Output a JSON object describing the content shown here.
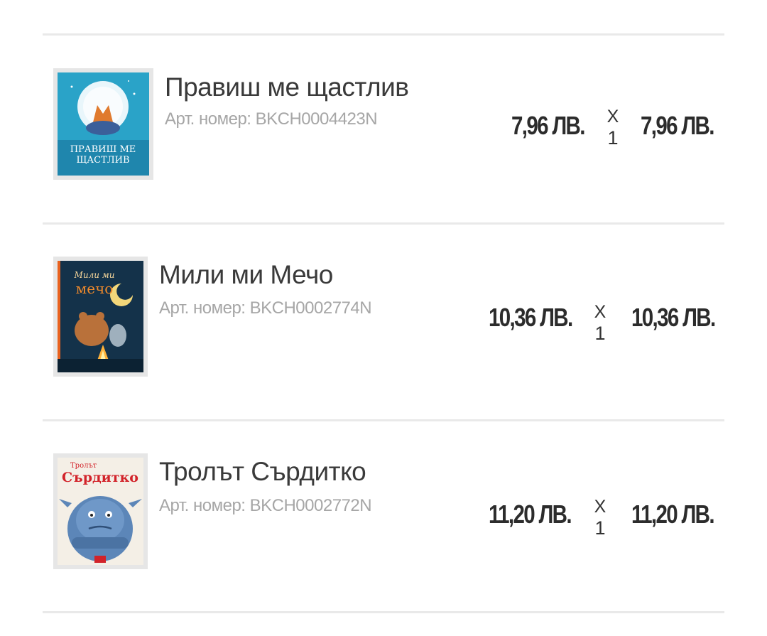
{
  "cart": {
    "items": [
      {
        "title": "Правиш ме щастлив",
        "sku": "Арт. номер: BKCH0004423N",
        "price": "7,96 ЛВ.",
        "qty_sep": "X",
        "qty": "1",
        "total": "7,96 ЛВ.",
        "cover_text": [
          "ПРАВИШ МЕ",
          "ЩАСТЛИВ"
        ],
        "cover_colors": {
          "bg": "#2aa3c8",
          "accent": "#e9f6fb"
        },
        "icon": "book-cover-fox-moon"
      },
      {
        "title": "Мили ми Мечо",
        "sku": "Арт. номер: BKCH0002774N",
        "price": "10,36 ЛВ.",
        "qty_sep": "X",
        "qty": "1",
        "total": "10,36 ЛВ.",
        "cover_text": [
          "Мили ми",
          "мечо"
        ],
        "cover_colors": {
          "bg": "#14324a",
          "accent": "#f08a2b"
        },
        "icon": "book-cover-bear-campfire"
      },
      {
        "title": "Тролът Сърдитко",
        "sku": "Арт. номер: BKCH0002772N",
        "price": "11,20 ЛВ.",
        "qty_sep": "X",
        "qty": "1",
        "total": "11,20 ЛВ.",
        "cover_text": [
          "Тролът",
          "Сърдитко"
        ],
        "cover_colors": {
          "bg": "#f4efe6",
          "accent": "#d2232a"
        },
        "icon": "book-cover-blue-troll"
      }
    ]
  }
}
